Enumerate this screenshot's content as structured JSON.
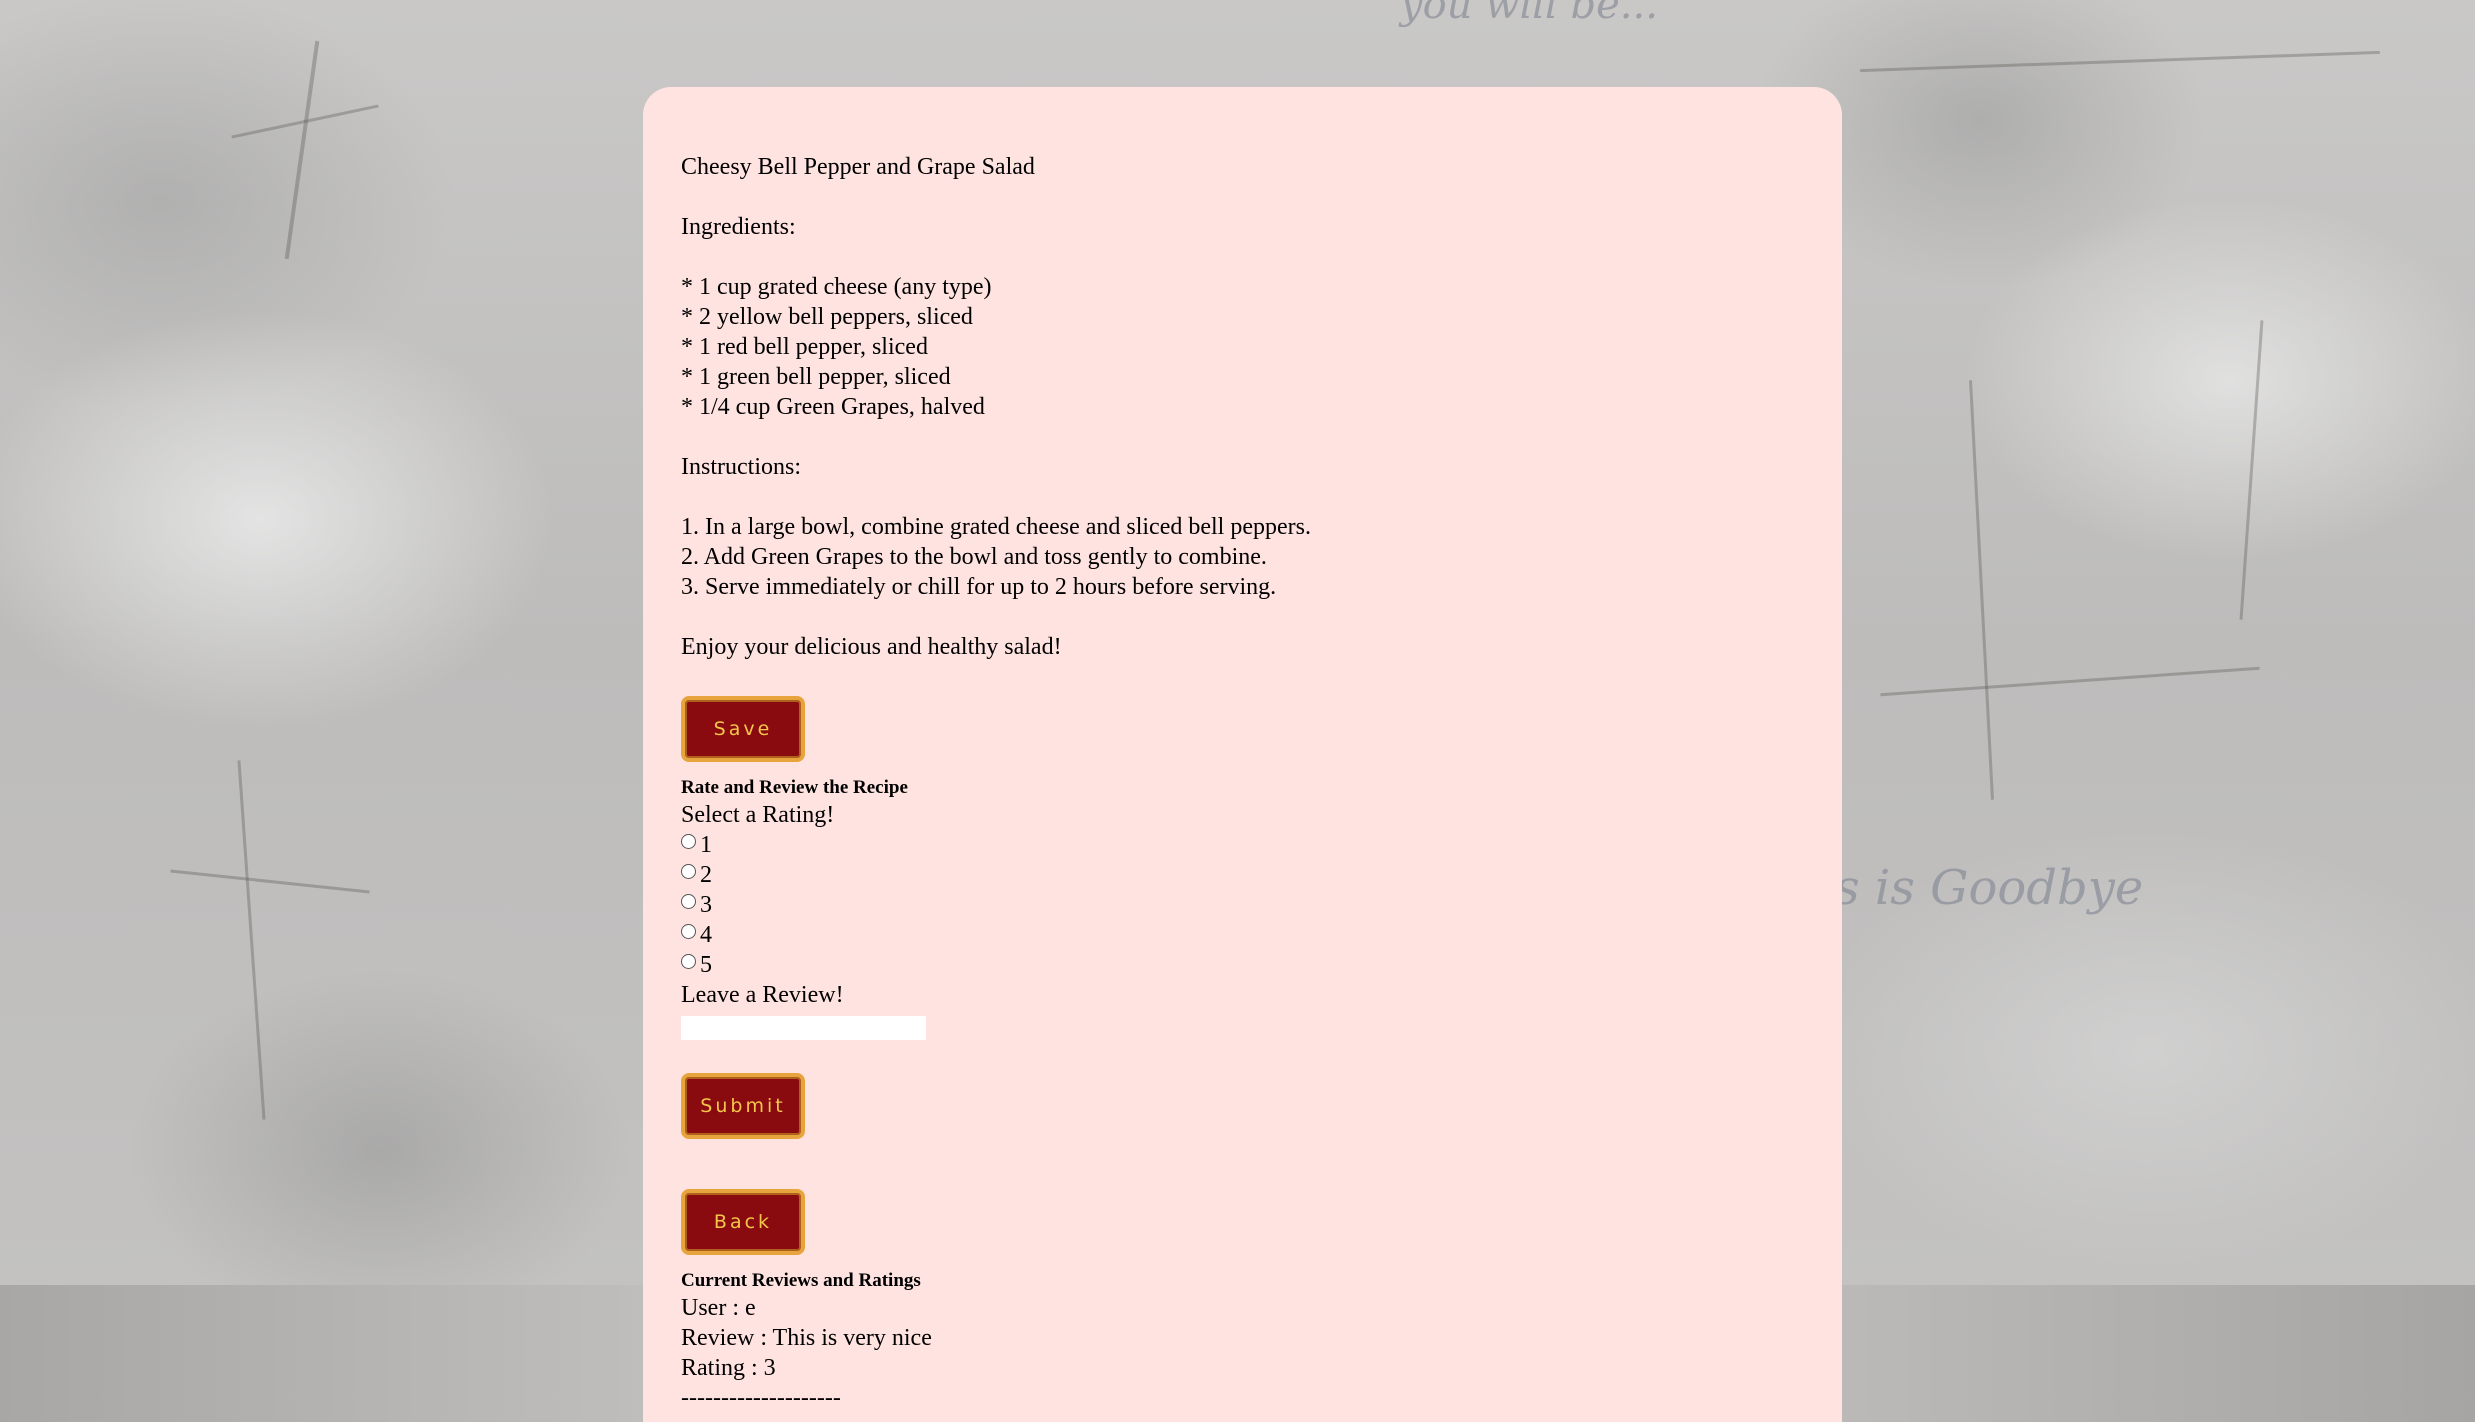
{
  "background": {
    "decor_text": "s is Goodbye",
    "top_decor_text": "you will be..."
  },
  "recipe": {
    "title": "Cheesy Bell Pepper and Grape Salad",
    "ingredients_heading": "Ingredients:",
    "ingredients": [
      "* 1 cup grated cheese (any type)",
      "* 2 yellow bell peppers, sliced",
      "* 1 red bell pepper, sliced",
      "* 1 green bell pepper, sliced",
      "* 1/4 cup Green Grapes, halved"
    ],
    "instructions_heading": "Instructions:",
    "instructions": [
      "1. In a large bowl, combine grated cheese and sliced bell peppers.",
      "2. Add Green Grapes to the bowl and toss gently to combine.",
      "3. Serve immediately or chill for up to 2 hours before serving."
    ],
    "closing": "Enjoy your delicious and healthy salad!"
  },
  "buttons": {
    "save": "Save",
    "submit": "Submit",
    "back": "Back"
  },
  "review_form": {
    "heading": "Rate and Review the Recipe",
    "rating_prompt": "Select a Rating!",
    "rating_options": [
      "1",
      "2",
      "3",
      "4",
      "5"
    ],
    "review_prompt": "Leave a Review!",
    "review_value": ""
  },
  "current_reviews": {
    "heading": "Current Reviews and Ratings",
    "entries": [
      {
        "user": "User : e",
        "review": "Review : This is very nice",
        "rating": "Rating : 3",
        "separator": "--------------------"
      }
    ]
  },
  "colors": {
    "card_background": "#fee3e0",
    "button_fill": "#8a0b0f",
    "button_border": "#e7a43c",
    "button_text": "#f4c54b"
  }
}
